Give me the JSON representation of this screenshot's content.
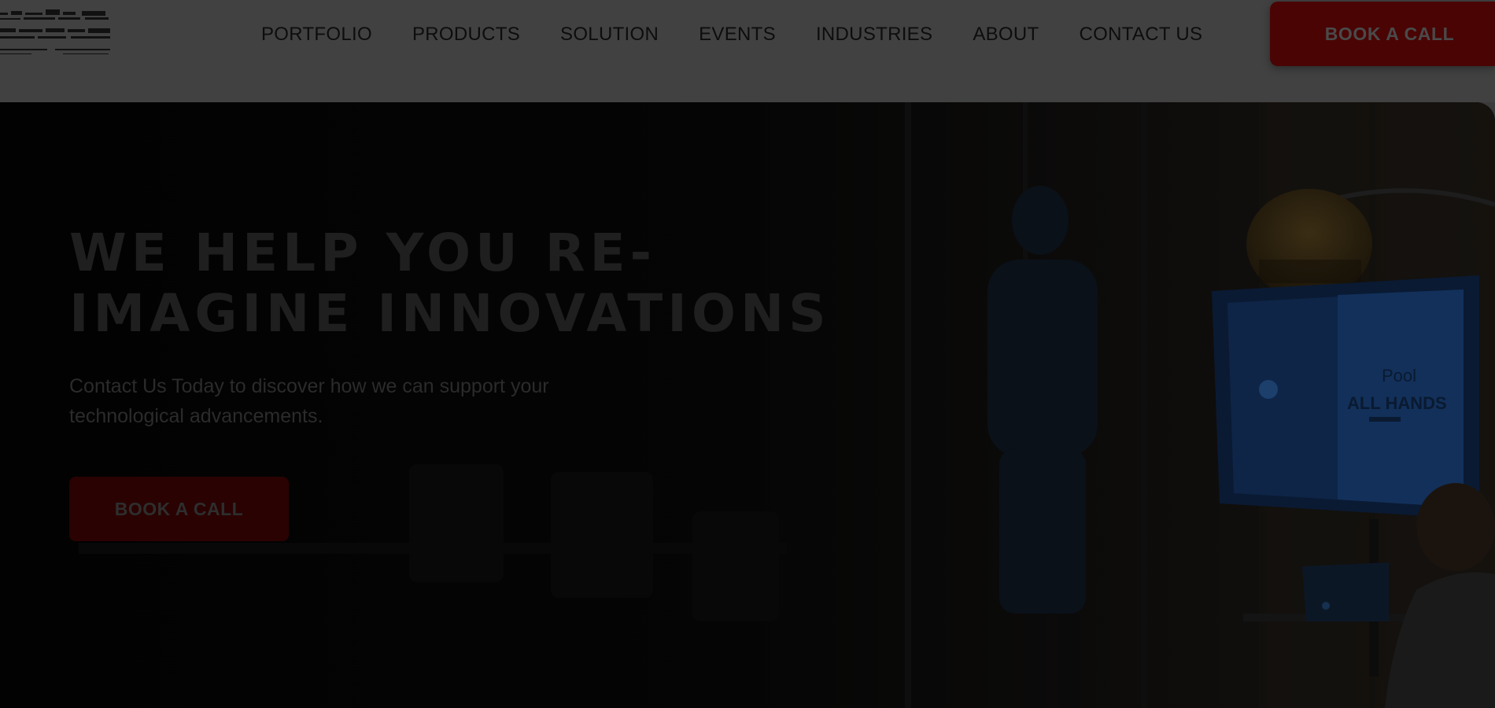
{
  "header": {
    "logo_icon": "company-logo-icon",
    "nav": [
      {
        "label": "PORTFOLIO"
      },
      {
        "label": "PRODUCTS"
      },
      {
        "label": "SOLUTION"
      },
      {
        "label": "EVENTS"
      },
      {
        "label": "INDUSTRIES"
      },
      {
        "label": "ABOUT"
      },
      {
        "label": "CONTACT US"
      }
    ],
    "cta_label": "BOOK A CALL"
  },
  "hero": {
    "title": "WE HELP YOU RE-IMAGINE INNOVATIONS",
    "subtitle": "Contact Us Today to discover how we can support your technological advancements.",
    "cta_label": "BOOK A CALL",
    "photo": {
      "screen_line1": "Pool",
      "screen_line2": "ALL HANDS"
    }
  },
  "colors": {
    "overlay": "#030303",
    "header_bg": "#414141",
    "accent_dark_red": "#4a0404"
  }
}
